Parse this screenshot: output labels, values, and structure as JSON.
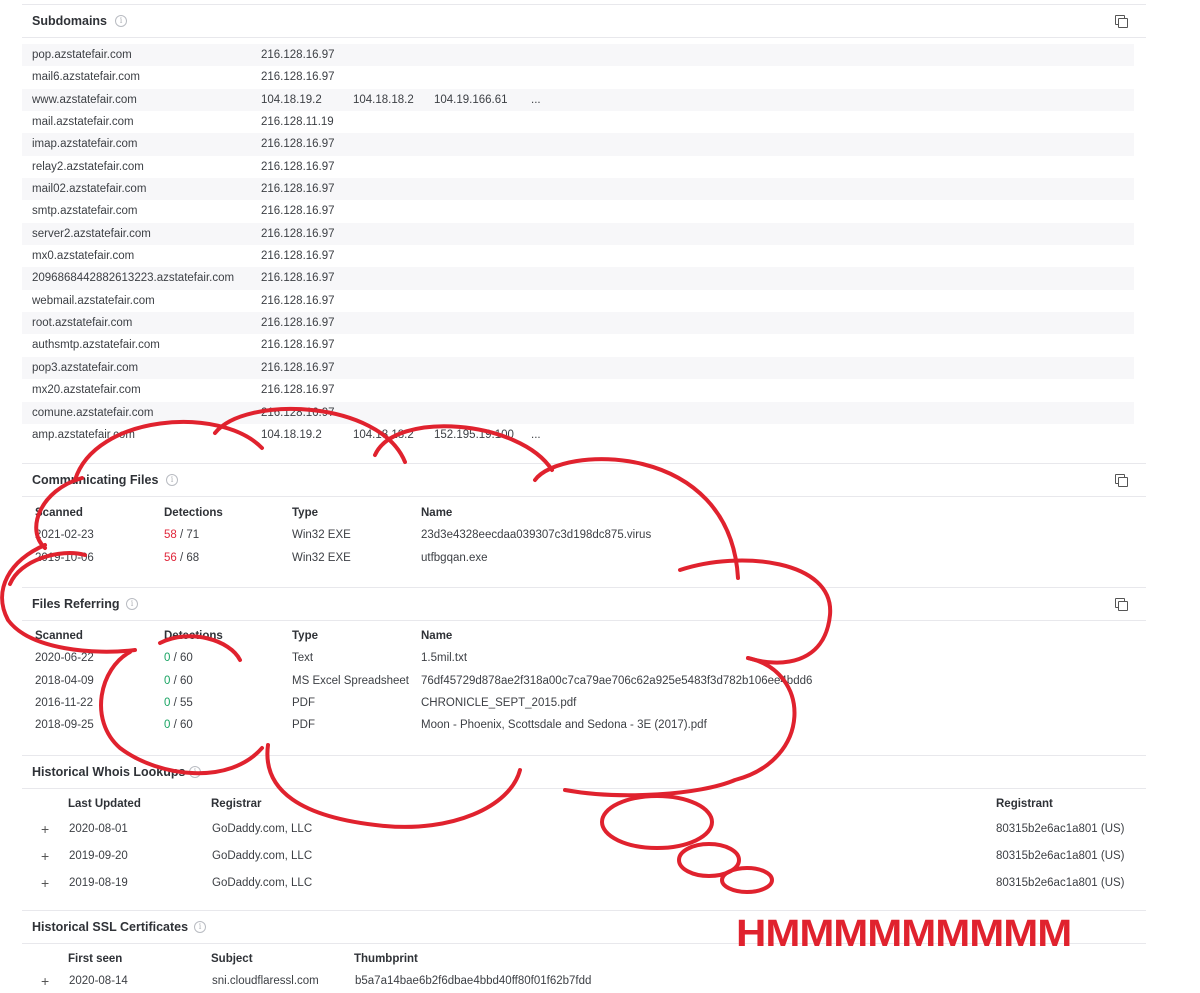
{
  "subdomains": {
    "title": "Subdomains",
    "rows": [
      {
        "host": "pop.azstatefair.com",
        "ips": [
          "216.128.16.97"
        ]
      },
      {
        "host": "mail6.azstatefair.com",
        "ips": [
          "216.128.16.97"
        ]
      },
      {
        "host": "www.azstatefair.com",
        "ips": [
          "104.18.19.2",
          "104.18.18.2",
          "104.19.166.61"
        ],
        "more": "..."
      },
      {
        "host": "mail.azstatefair.com",
        "ips": [
          "216.128.11.19"
        ]
      },
      {
        "host": "imap.azstatefair.com",
        "ips": [
          "216.128.16.97"
        ]
      },
      {
        "host": "relay2.azstatefair.com",
        "ips": [
          "216.128.16.97"
        ]
      },
      {
        "host": "mail02.azstatefair.com",
        "ips": [
          "216.128.16.97"
        ]
      },
      {
        "host": "smtp.azstatefair.com",
        "ips": [
          "216.128.16.97"
        ]
      },
      {
        "host": "server2.azstatefair.com",
        "ips": [
          "216.128.16.97"
        ]
      },
      {
        "host": "mx0.azstatefair.com",
        "ips": [
          "216.128.16.97"
        ]
      },
      {
        "host": "2096868442882613223.azstatefair.com",
        "ips": [
          "216.128.16.97"
        ]
      },
      {
        "host": "webmail.azstatefair.com",
        "ips": [
          "216.128.16.97"
        ]
      },
      {
        "host": "root.azstatefair.com",
        "ips": [
          "216.128.16.97"
        ]
      },
      {
        "host": "authsmtp.azstatefair.com",
        "ips": [
          "216.128.16.97"
        ]
      },
      {
        "host": "pop3.azstatefair.com",
        "ips": [
          "216.128.16.97"
        ]
      },
      {
        "host": "mx20.azstatefair.com",
        "ips": [
          "216.128.16.97"
        ]
      },
      {
        "host": "comune.azstatefair.com",
        "ips": [
          "216.128.16.97"
        ]
      },
      {
        "host": "amp.azstatefair.com",
        "ips": [
          "104.18.19.2",
          "104.18.18.2",
          "152.195.19.100"
        ],
        "more": "..."
      }
    ]
  },
  "communicating_files": {
    "title": "Communicating Files",
    "headers": {
      "scanned": "Scanned",
      "detections": "Detections",
      "type": "Type",
      "name": "Name"
    },
    "rows": [
      {
        "scanned": "2021-02-23",
        "det": "58",
        "total": "/ 71",
        "type": "Win32 EXE",
        "name": "23d3e4328eecdaa039307c3d198dc875.virus"
      },
      {
        "scanned": "2019-10-06",
        "det": "56",
        "total": "/ 68",
        "type": "Win32 EXE",
        "name": "utfbgqan.exe"
      }
    ]
  },
  "files_referring": {
    "title": "Files Referring",
    "headers": {
      "scanned": "Scanned",
      "detections": "Detections",
      "type": "Type",
      "name": "Name"
    },
    "rows": [
      {
        "scanned": "2020-06-22",
        "det": "0",
        "total": "/ 60",
        "type": "Text",
        "name": "1.5mil.txt"
      },
      {
        "scanned": "2018-04-09",
        "det": "0",
        "total": "/ 60",
        "type": "MS Excel Spreadsheet",
        "name": "76df45729d878ae2f318a00c7ca79ae706c62a925e5483f3d782b106ee4bdd6"
      },
      {
        "scanned": "2016-11-22",
        "det": "0",
        "total": "/ 55",
        "type": "PDF",
        "name": "CHRONICLE_SEPT_2015.pdf"
      },
      {
        "scanned": "2018-09-25",
        "det": "0",
        "total": "/ 60",
        "type": "PDF",
        "name": "Moon - Phoenix, Scottsdale and Sedona - 3E (2017).pdf"
      }
    ]
  },
  "whois": {
    "title": "Historical Whois Lookups",
    "headers": {
      "last_updated": "Last Updated",
      "registrar": "Registrar",
      "registrant": "Registrant"
    },
    "expand": "+",
    "rows": [
      {
        "date": "2020-08-01",
        "registrar": "GoDaddy.com, LLC",
        "registrant": "80315b2e6ac1a801 (US)"
      },
      {
        "date": "2019-09-20",
        "registrar": "GoDaddy.com, LLC",
        "registrant": "80315b2e6ac1a801 (US)"
      },
      {
        "date": "2019-08-19",
        "registrar": "GoDaddy.com, LLC",
        "registrant": "80315b2e6ac1a801 (US)"
      }
    ]
  },
  "ssl": {
    "title": "Historical SSL Certificates",
    "headers": {
      "first_seen": "First seen",
      "subject": "Subject",
      "thumbprint": "Thumbprint"
    },
    "expand": "+",
    "rows": [
      {
        "first_seen": "2020-08-14",
        "subject": "sni.cloudflaressl.com",
        "thumbprint": "b5a7a14bae6b2f6dbae4bbd40ff80f01f62b7fdd"
      }
    ]
  },
  "annotation": {
    "text": "HMMMMMMMMM",
    "color": "#e0222e"
  },
  "icons": {
    "info": "info-icon",
    "copy": "copy-icon"
  }
}
